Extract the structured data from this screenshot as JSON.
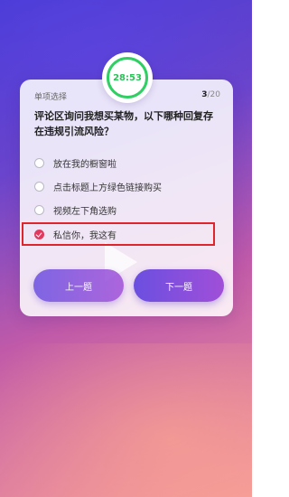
{
  "timer": {
    "value": "28:53"
  },
  "question": {
    "type": "单项选择",
    "current": "3",
    "total": "/20",
    "text": "评论区询问我想买某物，以下哪种回复存在违规引流风险？"
  },
  "options": [
    {
      "label": "放在我的橱窗啦",
      "selected": false
    },
    {
      "label": "点击标题上方绿色链接购买",
      "selected": false
    },
    {
      "label": "视频左下角选购",
      "selected": false
    },
    {
      "label": "私信你，我这有",
      "selected": true
    }
  ],
  "buttons": {
    "prev": "上一题",
    "next": "下一题"
  },
  "colors": {
    "accent": "#e23a5f",
    "timer": "#2fcf63",
    "highlight": "#e0242c",
    "button_start": "#6b4fe0",
    "button_end": "#a04fd8"
  },
  "icons": [
    "check-radio-icon",
    "play-icon"
  ]
}
